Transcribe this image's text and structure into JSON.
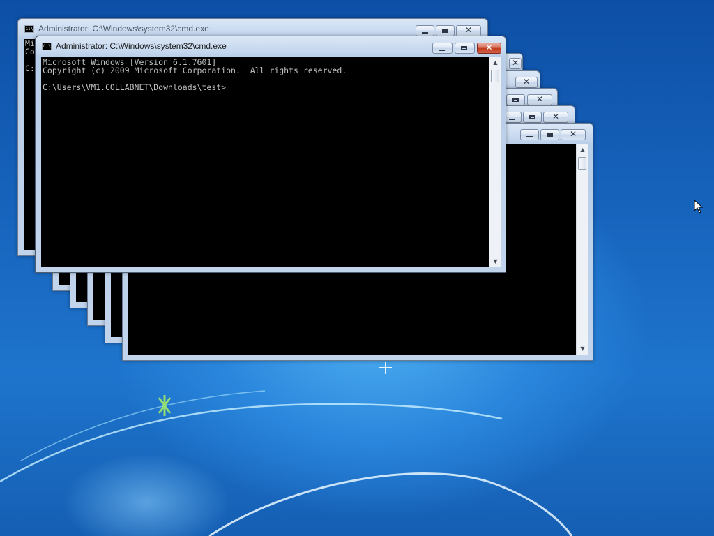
{
  "desktop": {
    "background": "#1f6fc4"
  },
  "windows": {
    "active": {
      "title": "Administrator: C:\\Windows\\system32\\cmd.exe",
      "console_lines": [
        "Microsoft Windows [Version 6.1.7601]",
        "Copyright (c) 2009 Microsoft Corporation.  All rights reserved.",
        "",
        "C:\\Users\\VM1.COLLABNET\\Downloads\\test>"
      ]
    },
    "back_top": {
      "title": "Administrator: C:\\Windows\\system32\\cmd.exe",
      "console_lines": [
        "Mi",
        "Co",
        "",
        "C:"
      ]
    }
  },
  "icons": {
    "window_icon": "cmd-icon",
    "minimize": "minimize-icon",
    "maximize": "maximize-icon",
    "close": "close-icon",
    "pointer": "mouse-pointer-icon"
  },
  "colors": {
    "close_active": "#c2391c",
    "console_bg": "#000000",
    "console_text": "#c0c0c0"
  }
}
